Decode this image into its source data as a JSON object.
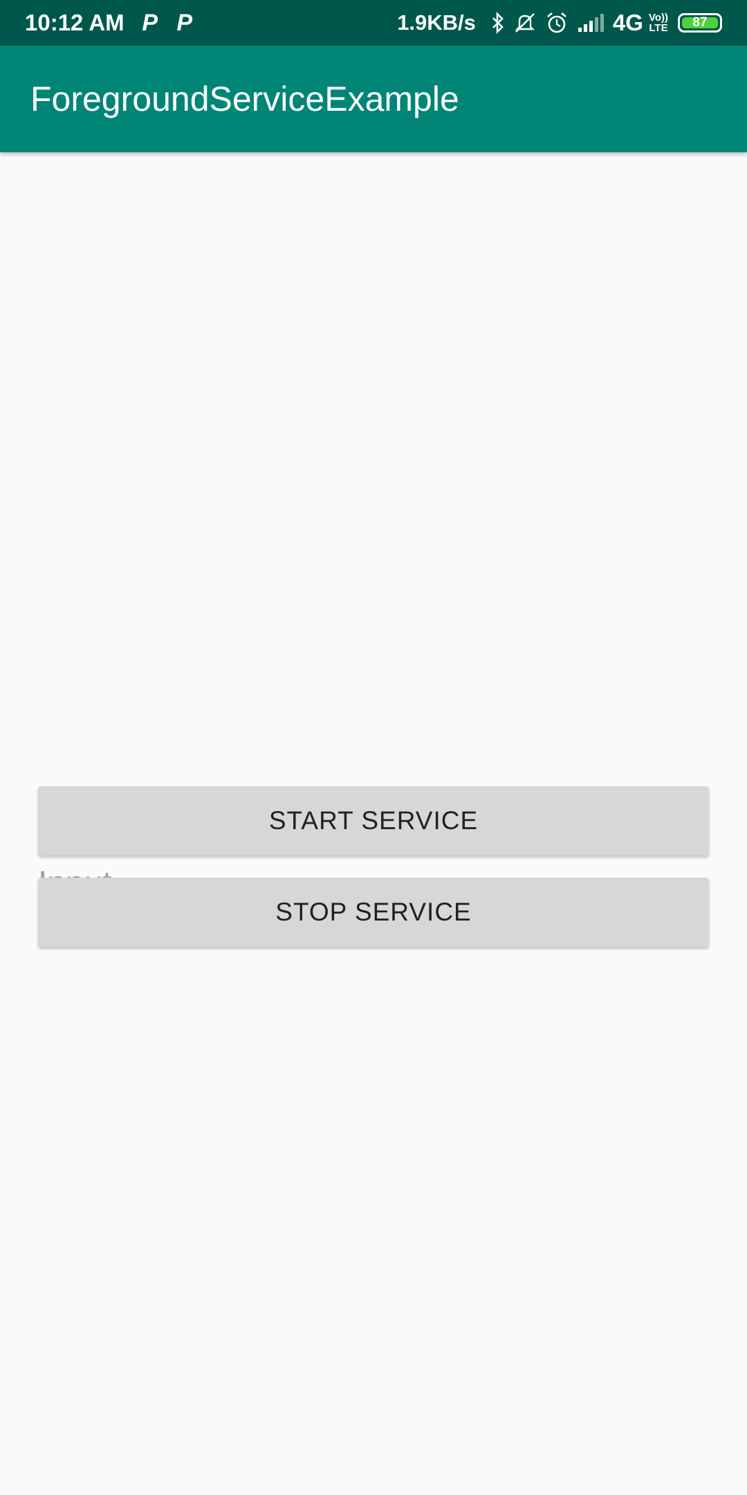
{
  "status_bar": {
    "time": "10:12 AM",
    "notif_icon_1": "P",
    "notif_icon_2": "P",
    "net_speed": "1.9KB/s",
    "network": "4G",
    "lte_top": "Vo))",
    "lte_bottom": "LTE",
    "battery": "87",
    "icons": [
      "bluetooth-icon",
      "silent-icon",
      "alarm-icon",
      "signal-icon"
    ]
  },
  "app_bar": {
    "title": "ForegroundServiceExample"
  },
  "form": {
    "input_placeholder": "Input",
    "input_value": "",
    "start_label": "START SERVICE",
    "stop_label": "STOP SERVICE"
  },
  "colors": {
    "status_bar": "#00574b",
    "app_bar": "#008577",
    "button": "#d6d7d7",
    "background": "#fafafa"
  }
}
